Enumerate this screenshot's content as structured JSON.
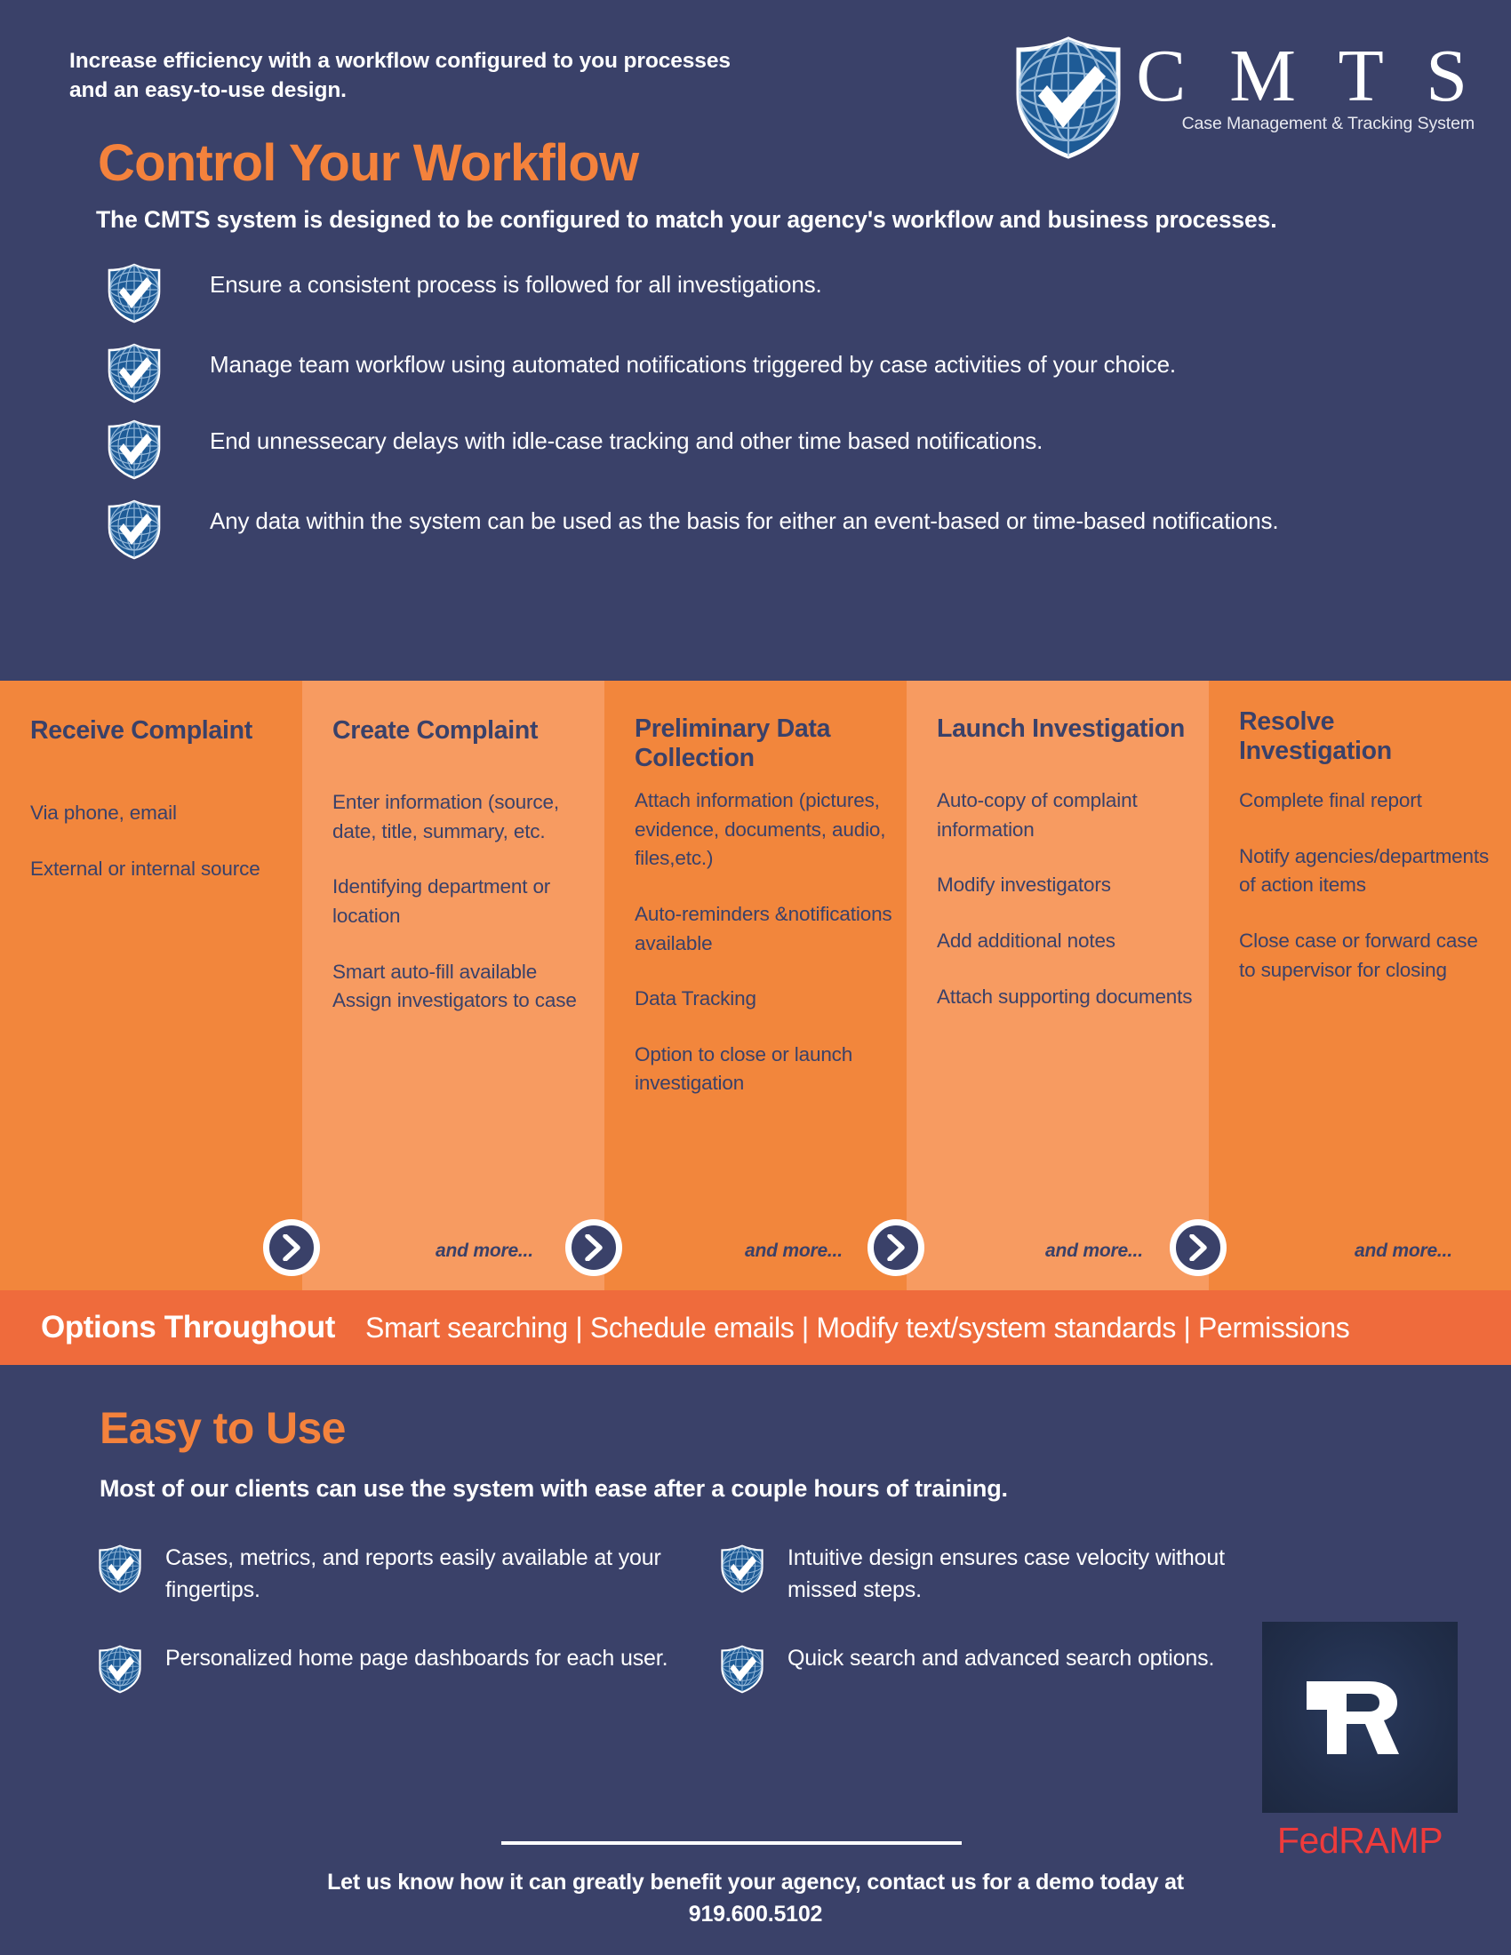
{
  "header": {
    "tagline": "Increase efficiency with a workflow configured to you processes and an easy-to-use design.",
    "title": "Control Your Workflow",
    "subtitle": "The CMTS system is designed to be configured to match your agency's workflow and business processes.",
    "logo": {
      "wordmark": "C M T S",
      "tagline": "Case Management & Tracking System",
      "icon": "shield-globe-check-icon"
    }
  },
  "top_bullets": [
    "Ensure a consistent process is followed for all investigations.",
    "Manage team workflow using automated notifications triggered by case activities of your choice.",
    "End unnessecary delays with idle-case tracking and other time based notifications.",
    "Any data within the system can be used as the basis for either an event-based or time-based notifications."
  ],
  "workflow": {
    "and_more_label": "and more...",
    "columns": [
      {
        "title": "Receive Complaint",
        "items": [
          "Via phone, email",
          "External or internal source"
        ]
      },
      {
        "title": "Create Complaint",
        "items": [
          "Enter information (source, date, title, summary, etc.",
          "Identifying department or location",
          "Smart auto-fill available Assign investigators to case"
        ]
      },
      {
        "title": "Preliminary Data Collection",
        "items": [
          "Attach information (pictures, evidence, documents, audio, files,etc.)",
          "Auto-reminders &notifications available",
          "Data Tracking",
          "Option to close or launch investigation"
        ]
      },
      {
        "title": "Launch Investigation",
        "items": [
          "Auto-copy of complaint information",
          "Modify investigators",
          "Add additional notes",
          "Attach supporting documents"
        ]
      },
      {
        "title": "Resolve Investigation",
        "items": [
          "Complete final report",
          "Notify agencies/departments of action items",
          "Close case or forward case to supervisor for closing"
        ]
      }
    ]
  },
  "options_banner": {
    "title": "Options Throughout",
    "list": "Smart searching | Schedule emails | Modify text/system standards | Permissions"
  },
  "easy": {
    "title": "Easy to Use",
    "subtitle": "Most of our clients can use the system with ease after a couple hours of training.",
    "bullets": [
      "Cases, metrics, and reports easily available at your fingertips.",
      "Intuitive design ensures case velocity without missed steps.",
      "Personalized home page dashboards for each user.",
      "Quick search and advanced search options."
    ]
  },
  "fedramp": {
    "monogram": "FR",
    "label": "FedRAMP"
  },
  "footer": {
    "line1": "Let us know how it can greatly benefit your agency, contact us for a demo today at",
    "line2": "919.600.5102"
  },
  "colors": {
    "navy": "#3a4169",
    "orange_dark": "#f2863c",
    "orange_light": "#f79b61",
    "orange_banner": "#ef6b3c",
    "accent_orange": "#f4823c",
    "fedramp_red": "#ef3b3b"
  }
}
